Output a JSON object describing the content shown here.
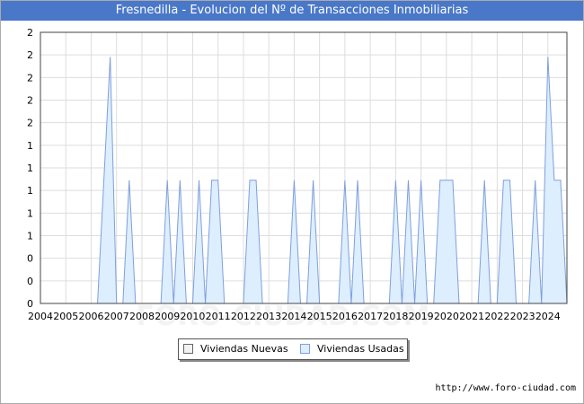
{
  "title": "Fresnedilla - Evolucion del Nº de Transacciones Inmobiliarias",
  "source": "http://www.foro-ciudad.com",
  "watermark": "FORO-CIUDAD.COM",
  "colors": {
    "title_bg": "#4a78c8",
    "nuevas_fill": "#f2f2f2",
    "nuevas_stroke": "#666666",
    "usadas_fill": "#ddeeff",
    "usadas_stroke": "#7f9fdc",
    "grid": "#dddddd"
  },
  "legend": {
    "nuevas": "Viviendas Nuevas",
    "usadas": "Viviendas Usadas"
  },
  "chart_data": {
    "type": "area",
    "title": "Fresnedilla - Evolucion del Nº de Transacciones Inmobiliarias",
    "xlabel": "",
    "ylabel": "",
    "x_range": [
      2004,
      2024.75
    ],
    "ylim": [
      0,
      2.2
    ],
    "y_tick_labels": [
      "0",
      "0",
      "0",
      "1",
      "1",
      "1",
      "1",
      "1",
      "2",
      "2",
      "2",
      "2"
    ],
    "x_tick_labels": [
      "2004",
      "2005",
      "2006",
      "2007",
      "2008",
      "2009",
      "2010",
      "2011",
      "2012",
      "2013",
      "2014",
      "2015",
      "2016",
      "2017",
      "2018",
      "2019",
      "2020",
      "2021",
      "2022",
      "2023",
      "2024"
    ],
    "grid": true,
    "legend_position": "bottom-center",
    "series": [
      {
        "name": "Viviendas Nuevas",
        "values": [],
        "note_values": "all zero"
      },
      {
        "name": "Viviendas Usadas",
        "points": [
          [
            2004.0,
            0
          ],
          [
            2006.25,
            0
          ],
          [
            2006.5,
            1
          ],
          [
            2006.75,
            2
          ],
          [
            2007.0,
            0
          ],
          [
            2007.25,
            0
          ],
          [
            2007.5,
            1
          ],
          [
            2007.75,
            0
          ],
          [
            2008.75,
            0
          ],
          [
            2009.0,
            1
          ],
          [
            2009.25,
            0
          ],
          [
            2009.5,
            1
          ],
          [
            2009.75,
            0
          ],
          [
            2010.0,
            0
          ],
          [
            2010.25,
            1
          ],
          [
            2010.5,
            0
          ],
          [
            2010.75,
            1
          ],
          [
            2011.0,
            1
          ],
          [
            2011.25,
            0
          ],
          [
            2012.0,
            0
          ],
          [
            2012.25,
            1
          ],
          [
            2012.5,
            1
          ],
          [
            2012.75,
            0
          ],
          [
            2013.75,
            0
          ],
          [
            2014.0,
            1
          ],
          [
            2014.25,
            0
          ],
          [
            2014.5,
            0
          ],
          [
            2014.75,
            1
          ],
          [
            2015.0,
            0
          ],
          [
            2015.75,
            0
          ],
          [
            2016.0,
            1
          ],
          [
            2016.25,
            0
          ],
          [
            2016.5,
            1
          ],
          [
            2016.75,
            0
          ],
          [
            2017.75,
            0
          ],
          [
            2018.0,
            1
          ],
          [
            2018.25,
            0
          ],
          [
            2018.5,
            1
          ],
          [
            2018.75,
            0
          ],
          [
            2019.0,
            1
          ],
          [
            2019.25,
            0
          ],
          [
            2019.5,
            0
          ],
          [
            2019.75,
            1
          ],
          [
            2020.0,
            1
          ],
          [
            2020.25,
            1
          ],
          [
            2020.5,
            0
          ],
          [
            2021.25,
            0
          ],
          [
            2021.5,
            1
          ],
          [
            2021.75,
            0
          ],
          [
            2022.0,
            0
          ],
          [
            2022.25,
            1
          ],
          [
            2022.5,
            1
          ],
          [
            2022.75,
            0
          ],
          [
            2023.25,
            0
          ],
          [
            2023.5,
            1
          ],
          [
            2023.75,
            0
          ],
          [
            2024.0,
            2
          ],
          [
            2024.25,
            1
          ],
          [
            2024.5,
            1
          ],
          [
            2024.75,
            0
          ]
        ]
      }
    ]
  }
}
